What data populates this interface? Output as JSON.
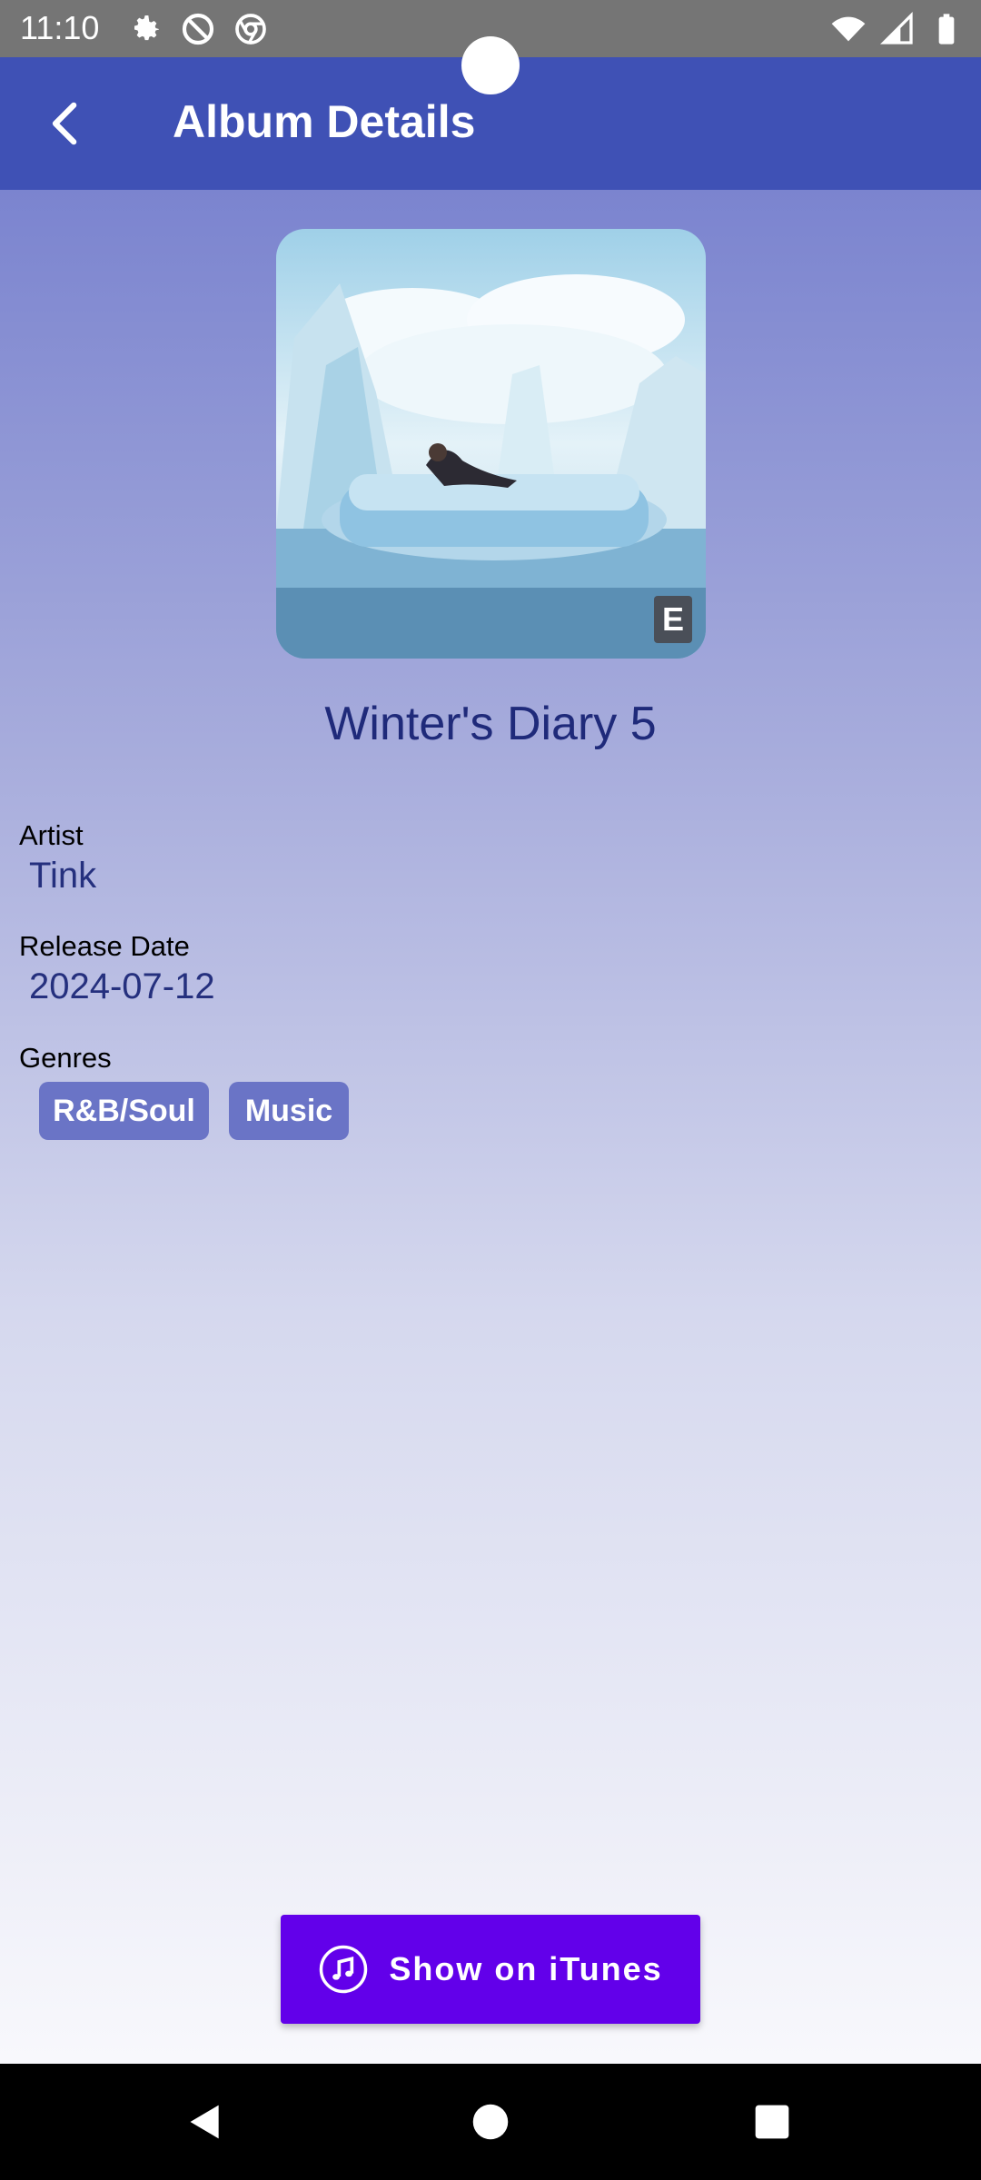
{
  "status_bar": {
    "time": "11:10"
  },
  "app_bar": {
    "title": "Album Details",
    "back_icon": "arrow-back-icon"
  },
  "album": {
    "title": "Winter's Diary 5",
    "explicit_badge": "E",
    "artist_label": "Artist",
    "artist": "Tink",
    "release_date_label": "Release Date",
    "release_date": "2024-07-12",
    "genres_label": "Genres",
    "genres": [
      "R&B/Soul",
      "Music"
    ]
  },
  "actions": {
    "itunes_label": "Show on iTunes",
    "itunes_icon": "music-note-icon"
  },
  "colors": {
    "app_bar": "#3f51b5",
    "accent": "#6200ea",
    "chip": "#6a74c6",
    "title_text": "#1f2a7a"
  }
}
